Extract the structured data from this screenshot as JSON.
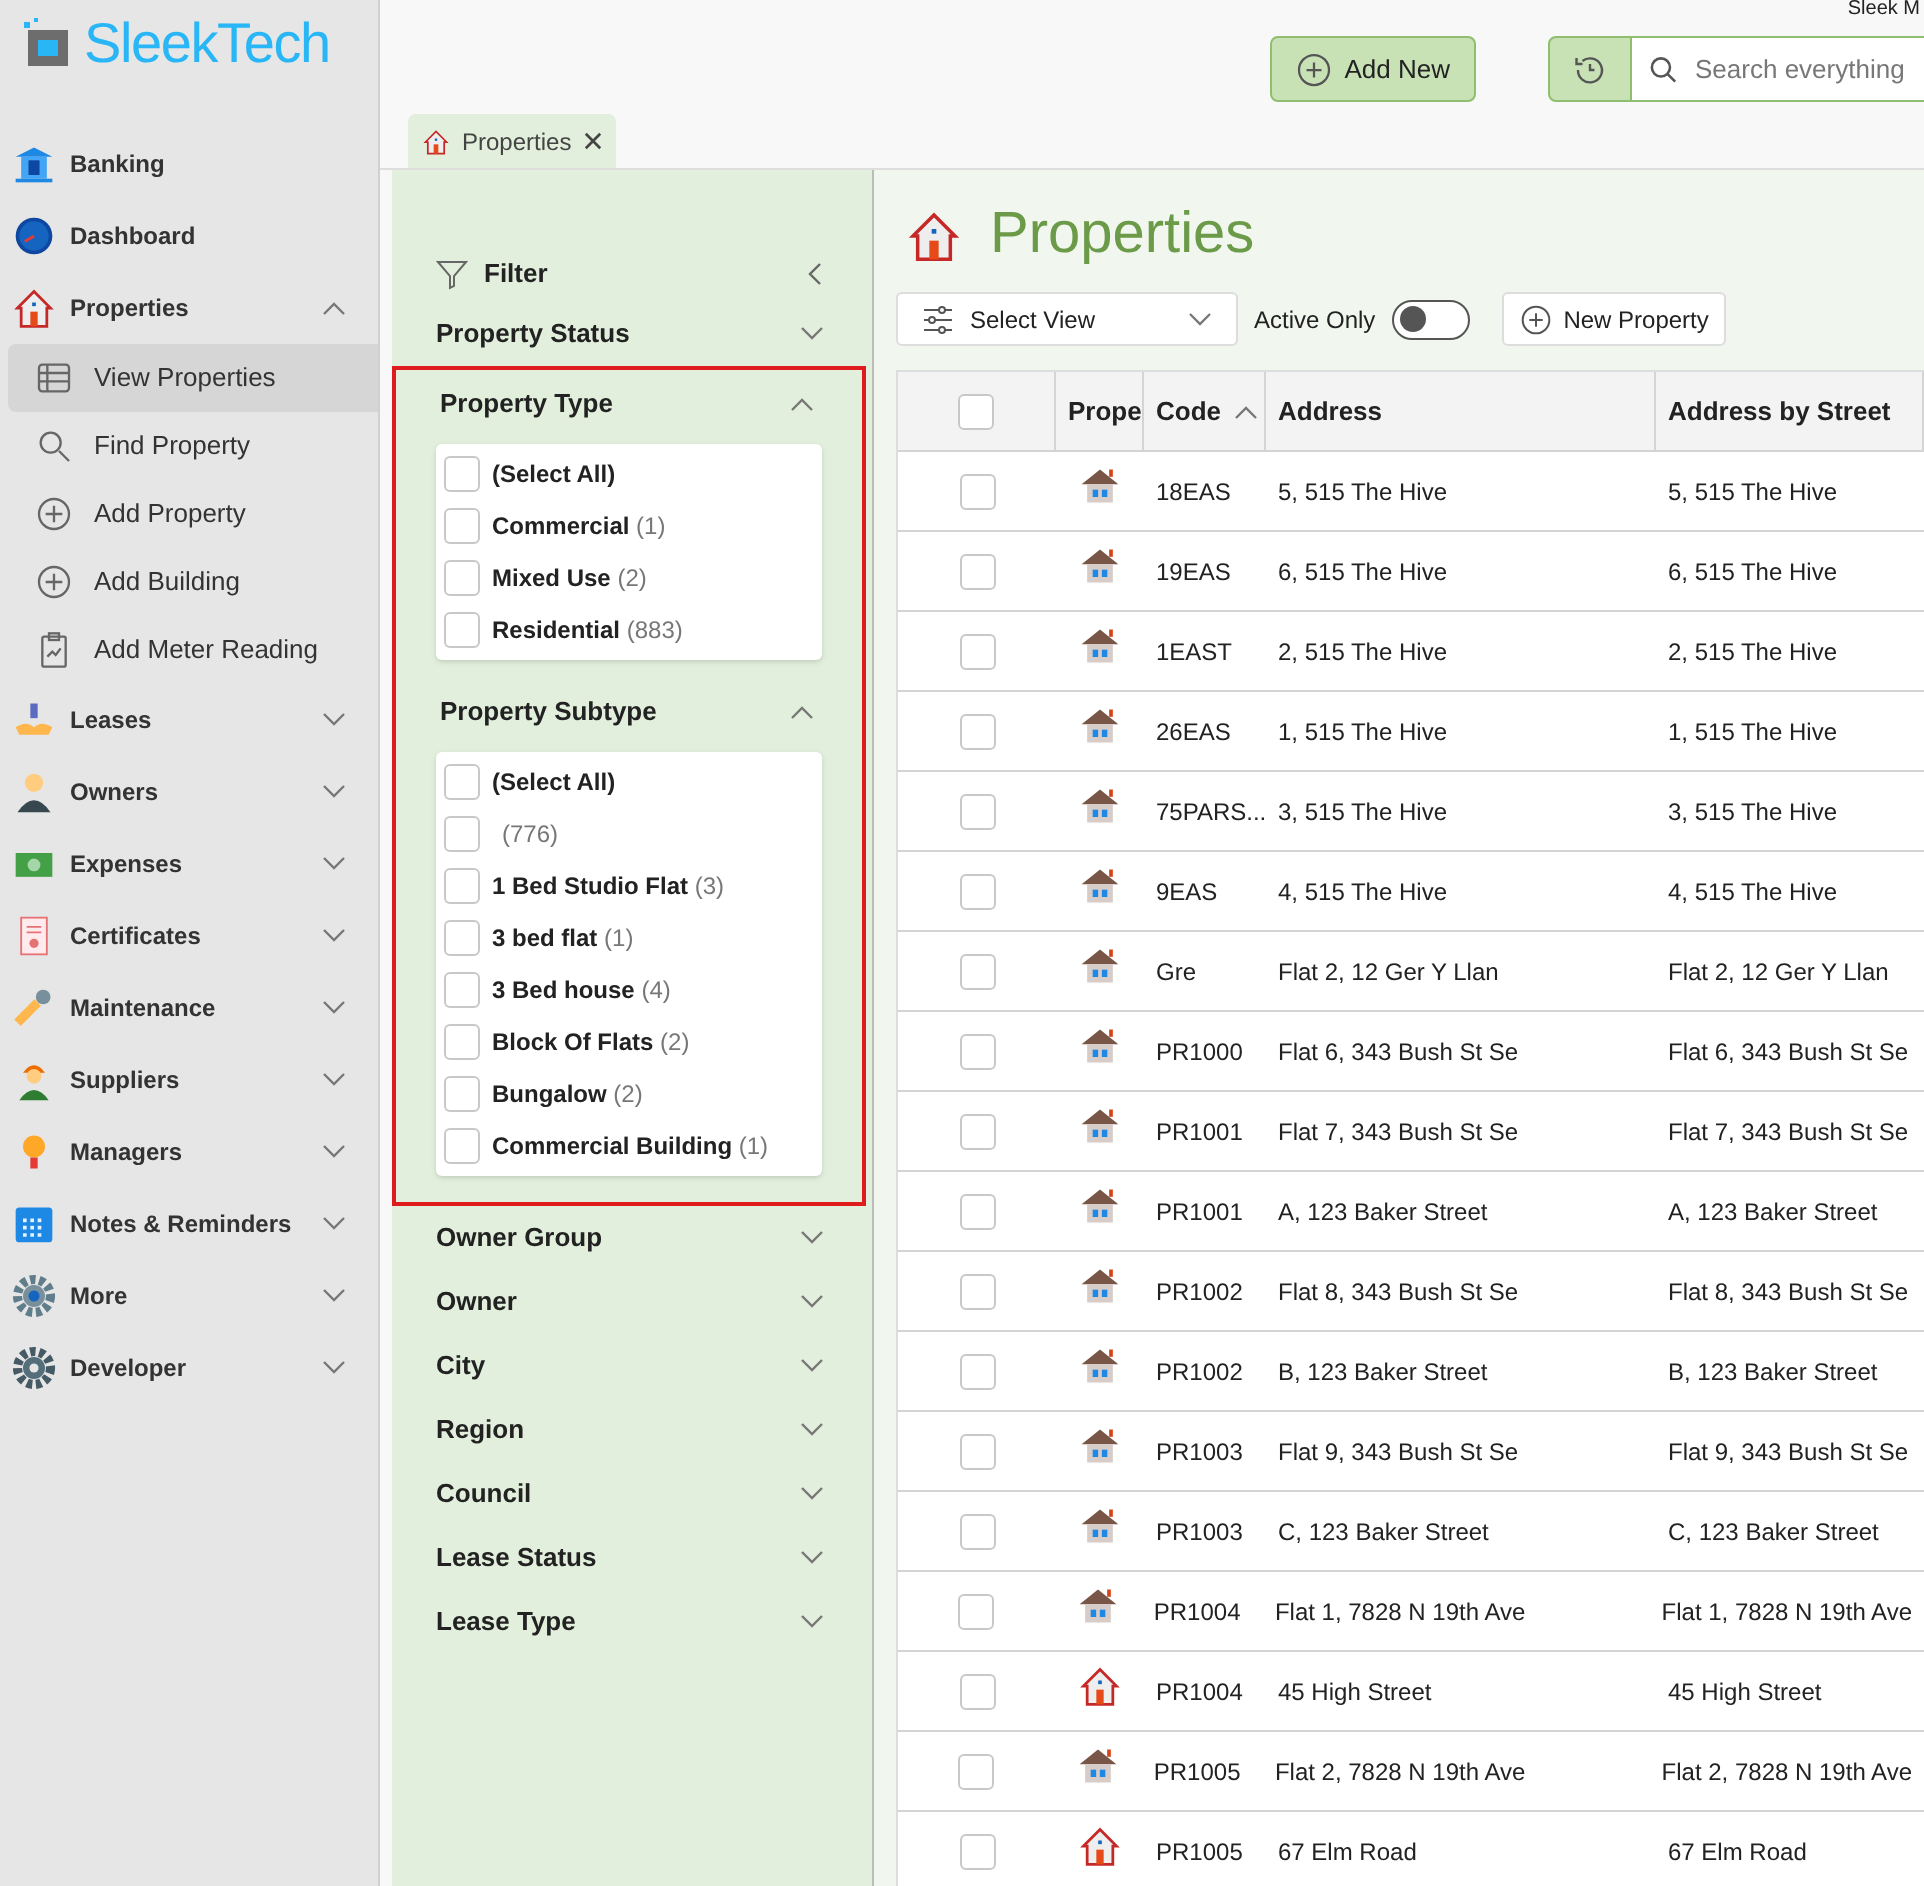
{
  "brand": {
    "name": "SleekTech"
  },
  "header": {
    "user_text": "Sleek M",
    "add_button": "Add New",
    "search": {
      "placeholder": "Search everything"
    }
  },
  "tabs": [
    {
      "label": "Properties",
      "selected": true
    }
  ],
  "sidebar": {
    "items": [
      {
        "label": "Banking"
      },
      {
        "label": "Dashboard"
      },
      {
        "label": "Properties",
        "expanded": true,
        "children": [
          {
            "label": "View Properties",
            "selected": true
          },
          {
            "label": "Find Property",
            "selected": false
          },
          {
            "label": "Add Property",
            "selected": false
          },
          {
            "label": "Add Building",
            "selected": false
          },
          {
            "label": "Add Meter Reading",
            "selected": false
          }
        ]
      },
      {
        "label": "Leases",
        "expanded": false
      },
      {
        "label": "Owners",
        "expanded": false
      },
      {
        "label": "Expenses",
        "expanded": false
      },
      {
        "label": "Certificates",
        "expanded": false
      },
      {
        "label": "Maintenance",
        "expanded": false
      },
      {
        "label": "Suppliers",
        "expanded": false
      },
      {
        "label": "Managers",
        "expanded": false
      },
      {
        "label": "Notes & Reminders",
        "expanded": false
      },
      {
        "label": "More",
        "expanded": false
      },
      {
        "label": "Developer",
        "expanded": false
      }
    ]
  },
  "filter": {
    "title": "Filter",
    "sections": [
      {
        "label": "Property Status",
        "expanded": false,
        "highlighted": false
      },
      {
        "label": "Property Type",
        "expanded": true,
        "highlighted": true,
        "options": [
          {
            "label": "(Select All)",
            "checked": false
          },
          {
            "label": "Commercial",
            "count": "(1)",
            "checked": false
          },
          {
            "label": "Mixed Use",
            "count": "(2)",
            "checked": false
          },
          {
            "label": "Residential",
            "count": "(883)",
            "checked": false
          }
        ]
      },
      {
        "label": "Property Subtype",
        "expanded": true,
        "highlighted": true,
        "options": [
          {
            "label": "(Select All)",
            "checked": false
          },
          {
            "count": "(776)",
            "checked": false
          },
          {
            "label": "1 Bed Studio Flat",
            "count": "(3)",
            "checked": false
          },
          {
            "label": "3 bed flat",
            "count": "(1)",
            "checked": false
          },
          {
            "label": "3 Bed house",
            "count": "(4)",
            "checked": false
          },
          {
            "label": "Block Of Flats",
            "count": "(2)",
            "checked": false
          },
          {
            "label": "Bungalow",
            "count": "(2)",
            "checked": false
          },
          {
            "label": "Commercial Building",
            "count": "(1)",
            "checked": false
          }
        ]
      },
      {
        "label": "Owner Group",
        "expanded": false,
        "highlighted": false
      },
      {
        "label": "Owner",
        "expanded": false,
        "highlighted": false
      },
      {
        "label": "City",
        "expanded": false,
        "highlighted": false
      },
      {
        "label": "Region",
        "expanded": false,
        "highlighted": false
      },
      {
        "label": "Council",
        "expanded": false,
        "highlighted": false
      },
      {
        "label": "Lease Status",
        "expanded": false,
        "highlighted": false
      },
      {
        "label": "Lease Type",
        "expanded": false,
        "highlighted": false
      }
    ]
  },
  "page": {
    "title": "Properties",
    "select_view": "Select View",
    "active_only": {
      "label": "Active Only",
      "on": false
    },
    "new_button": "New Property"
  },
  "table": {
    "select_all_checked": false,
    "columns": [
      {
        "label": "Prope",
        "sorted": false
      },
      {
        "label": "Code",
        "sorted": true
      },
      {
        "label": "Address",
        "sorted": false
      },
      {
        "label": "Address by Street",
        "sorted": false
      }
    ],
    "rows": [
      {
        "kind": "building",
        "code": "18EAS",
        "address": "5, 515 The Hive",
        "address_by_street": "5, 515 The Hive",
        "selected": false
      },
      {
        "kind": "building",
        "code": "19EAS",
        "address": "6, 515 The Hive",
        "address_by_street": "6, 515 The Hive",
        "selected": false
      },
      {
        "kind": "building",
        "code": "1EAST",
        "address": "2, 515 The Hive",
        "address_by_street": "2, 515 The Hive",
        "selected": false
      },
      {
        "kind": "building",
        "code": "26EAS",
        "address": "1, 515 The Hive",
        "address_by_street": "1, 515 The Hive",
        "selected": false
      },
      {
        "kind": "building",
        "code": "75PARS...",
        "address": "3, 515 The Hive",
        "address_by_street": "3, 515 The Hive",
        "selected": false
      },
      {
        "kind": "building",
        "code": "9EAS",
        "address": "4, 515 The Hive",
        "address_by_street": "4, 515 The Hive",
        "selected": false
      },
      {
        "kind": "building",
        "code": "Gre",
        "address": "Flat 2, 12 Ger Y Llan",
        "address_by_street": "Flat 2, 12 Ger Y Llan",
        "selected": false
      },
      {
        "kind": "building",
        "code": "PR1000",
        "address": "Flat 6, 343 Bush St Se",
        "address_by_street": "Flat 6, 343 Bush St Se",
        "selected": false
      },
      {
        "kind": "building",
        "code": "PR1001",
        "address": "Flat 7, 343 Bush St Se",
        "address_by_street": "Flat 7, 343 Bush St Se",
        "selected": false
      },
      {
        "kind": "building",
        "code": "PR1001",
        "address": "A, 123 Baker Street",
        "address_by_street": "A, 123 Baker Street",
        "selected": false
      },
      {
        "kind": "building",
        "code": "PR1002",
        "address": "Flat 8, 343 Bush St Se",
        "address_by_street": "Flat 8, 343 Bush St Se",
        "selected": false
      },
      {
        "kind": "building",
        "code": "PR1002",
        "address": "B, 123 Baker Street",
        "address_by_street": "B, 123 Baker Street",
        "selected": false
      },
      {
        "kind": "building",
        "code": "PR1003",
        "address": "Flat 9, 343 Bush St Se",
        "address_by_street": "Flat 9, 343 Bush St Se",
        "selected": false
      },
      {
        "kind": "building",
        "code": "PR1003",
        "address": "C, 123 Baker Street",
        "address_by_street": "C, 123 Baker Street",
        "selected": false
      },
      {
        "kind": "building",
        "code": "PR1004",
        "address": "Flat 1, 7828 N 19th Ave",
        "address_by_street": "Flat 1, 7828 N 19th Ave",
        "selected": false
      },
      {
        "kind": "house",
        "code": "PR1004",
        "address": "45 High Street",
        "address_by_street": "45 High Street",
        "selected": false
      },
      {
        "kind": "building",
        "code": "PR1005",
        "address": "Flat 2, 7828 N 19th Ave",
        "address_by_street": "Flat 2, 7828 N 19th Ave",
        "selected": false
      },
      {
        "kind": "house",
        "code": "PR1005",
        "address": "67 Elm Road",
        "address_by_street": "67 Elm Road",
        "selected": false
      }
    ]
  }
}
